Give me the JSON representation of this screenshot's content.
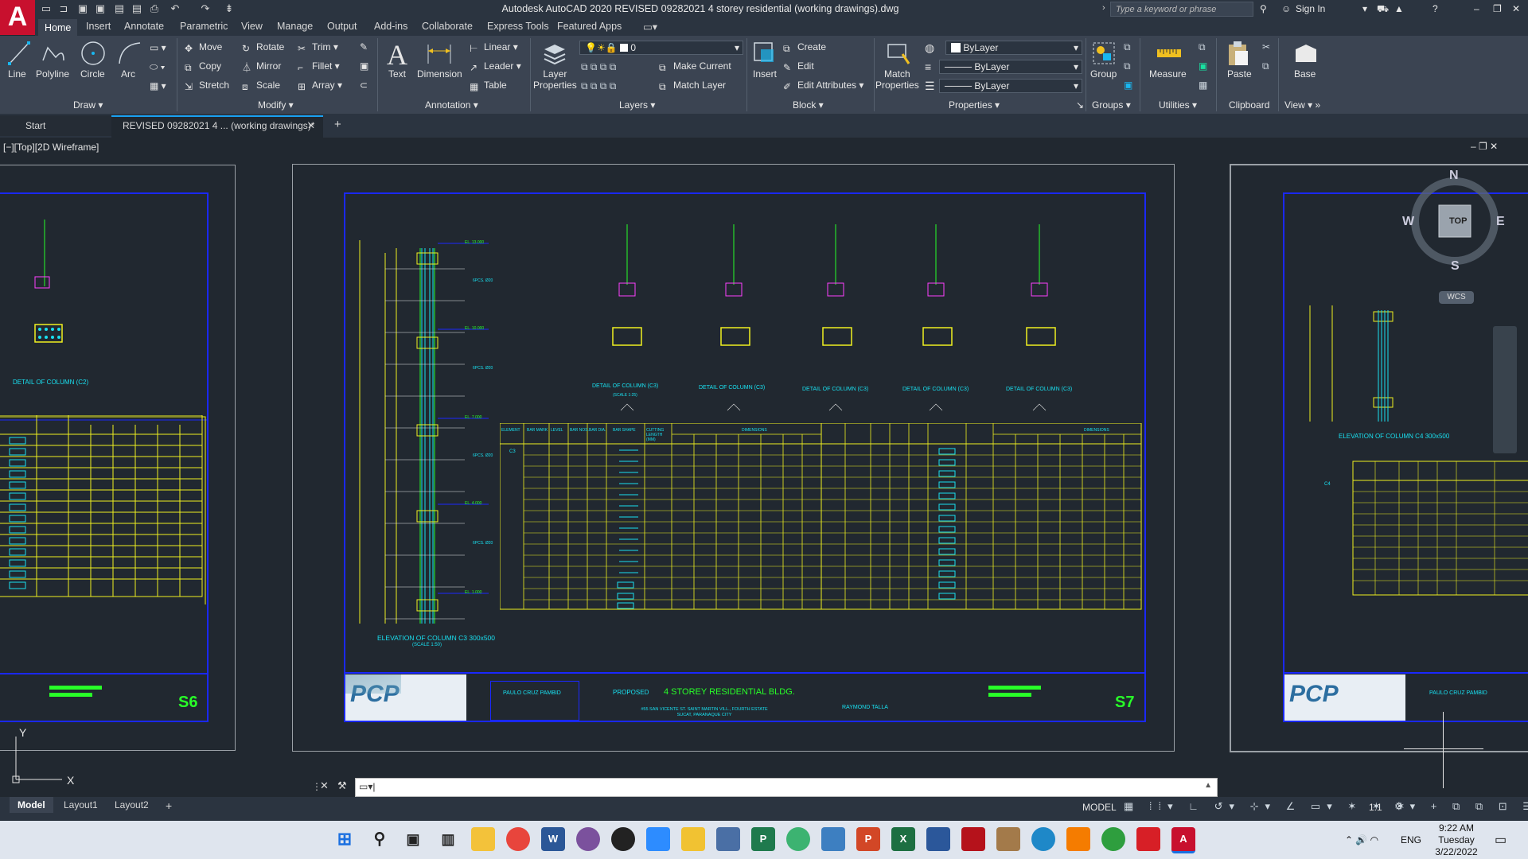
{
  "app": {
    "logo": "A",
    "title": "Autodesk AutoCAD 2020    REVISED 09282021 4 storey residential (working drawings).dwg",
    "search_placeholder": "Type a keyword or phrase",
    "sign_in": "Sign In"
  },
  "ribbon_tabs": [
    "Home",
    "Insert",
    "Annotate",
    "Parametric",
    "View",
    "Manage",
    "Output",
    "Add-ins",
    "Collaborate",
    "Express Tools",
    "Featured Apps"
  ],
  "ribbon": {
    "draw": {
      "title": "Draw",
      "line": "Line",
      "polyline": "Polyline",
      "circle": "Circle",
      "arc": "Arc"
    },
    "modify": {
      "title": "Modify",
      "move": "Move",
      "rotate": "Rotate",
      "trim": "Trim",
      "copy": "Copy",
      "mirror": "Mirror",
      "fillet": "Fillet",
      "stretch": "Stretch",
      "scale": "Scale",
      "array": "Array"
    },
    "annotation": {
      "title": "Annotation",
      "text": "Text",
      "dimension": "Dimension",
      "linear": "Linear",
      "leader": "Leader",
      "table": "Table"
    },
    "layers": {
      "title": "Layers",
      "layer_properties": "Layer Properties",
      "layer_value": "0",
      "make_current": "Make Current",
      "match_layer": "Match Layer"
    },
    "block": {
      "title": "Block",
      "insert": "Insert",
      "create": "Create",
      "edit": "Edit",
      "edit_attributes": "Edit Attributes"
    },
    "properties": {
      "title": "Properties",
      "match_properties": "Match Properties",
      "color": "ByLayer",
      "linetype": "ByLayer",
      "lineweight": "ByLayer"
    },
    "groups": {
      "title": "Groups",
      "group": "Group"
    },
    "utilities": {
      "title": "Utilities",
      "measure": "Measure"
    },
    "clipboard": {
      "title": "Clipboard",
      "paste": "Paste"
    },
    "view": {
      "title": "View",
      "base": "Base"
    }
  },
  "file_tabs": {
    "start": "Start",
    "active": "REVISED 09282021 4 ... (working drawings)*"
  },
  "viewport_label": "[−][Top][2D Wireframe]",
  "viewcube": {
    "n": "N",
    "s": "S",
    "e": "E",
    "w": "W",
    "top": "TOP",
    "wcs": "WCS"
  },
  "drawing": {
    "left_sheet_no": "S6",
    "center_sheet_no": "S7",
    "detail_label": "DETAIL OF COLUMN (C3)",
    "detail_scale": "(SCALE 1:25)",
    "left_detail_label": "DETAIL OF COLUMN (C2)",
    "elevation_label": "ELEVATION OF COLUMN C3 300x500",
    "elevation_scale": "(SCALE 1:50)",
    "right_elevation_label": "ELEVATION OF COLUMN C4 300x500",
    "project_title": "4 STOREY RESIDENTIAL BLDG.",
    "proposed": "PROPOSED",
    "engineer": "PAULO CRUZ PAMBID",
    "owner": "RAYMOND TALLA",
    "location": "#55 SAN VICENTE ST. SAINT MARTIN VILL., FOURTH ESTATE SUCAT, PARANAQUE CITY",
    "logo_text": "PCP",
    "table_headers": [
      "ELEMENT",
      "BAR MARK",
      "LEVEL",
      "BAR NOS.",
      "BAR DIA.",
      "BAR SHAPE",
      "CUTTING LENGTH (MM)",
      "DIMENSIONS"
    ],
    "dim_cols": [
      "A",
      "B",
      "C",
      "D",
      "E",
      "R"
    ],
    "element_c3": "C3",
    "element_c4": "C4"
  },
  "layout_tabs": [
    "Model",
    "Layout1",
    "Layout2"
  ],
  "status": {
    "model": "MODEL",
    "scale": "1:1"
  },
  "taskbar": {
    "lang": "ENG",
    "time": "9:22 AM",
    "day": "Tuesday",
    "date": "3/22/2022"
  }
}
